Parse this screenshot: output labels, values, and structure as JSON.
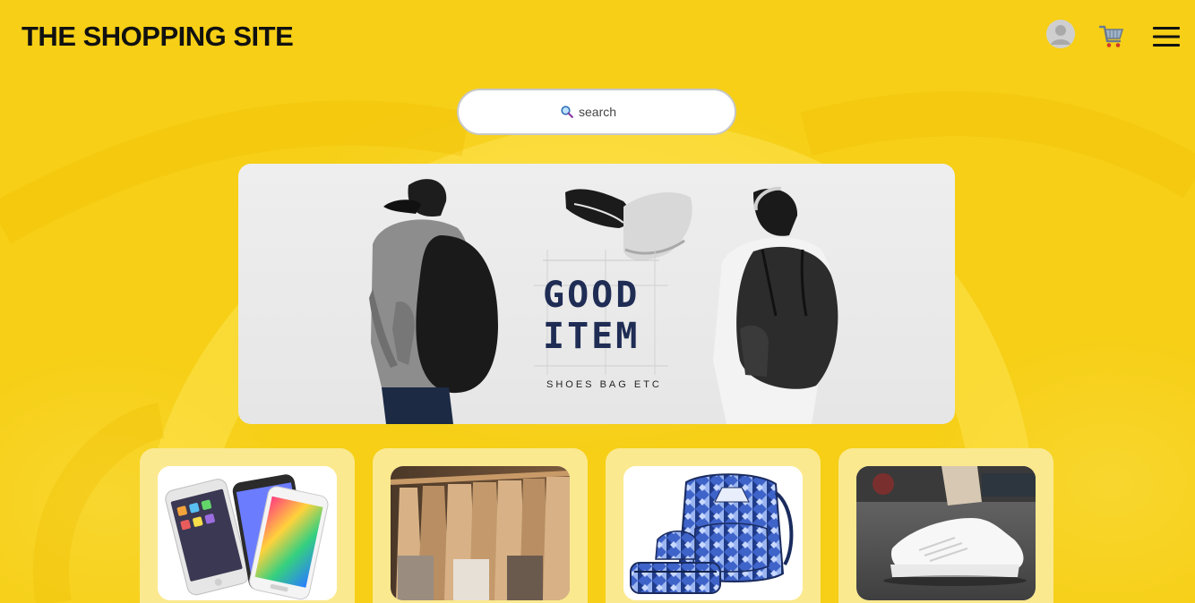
{
  "header": {
    "brand": "THE SHOPPING SITE",
    "icons": [
      "user-avatar-icon",
      "shopping-cart-icon",
      "hamburger-menu-icon"
    ]
  },
  "search": {
    "placeholder": "search",
    "icon": "magnifier-icon"
  },
  "banner": {
    "headline": "GOOD ITEM",
    "subline": "SHOES  BAG  ETC"
  },
  "categories": [
    {
      "name": "phones-category",
      "image": "smartphones"
    },
    {
      "name": "clothing-category",
      "image": "clothes-on-hangers"
    },
    {
      "name": "bags-category",
      "image": "backpack-set"
    },
    {
      "name": "shoes-category",
      "image": "white-sneakers"
    }
  ],
  "colors": {
    "background": "#f6cf16",
    "card": "#fbe98f",
    "banner_text": "#1f2d55"
  }
}
